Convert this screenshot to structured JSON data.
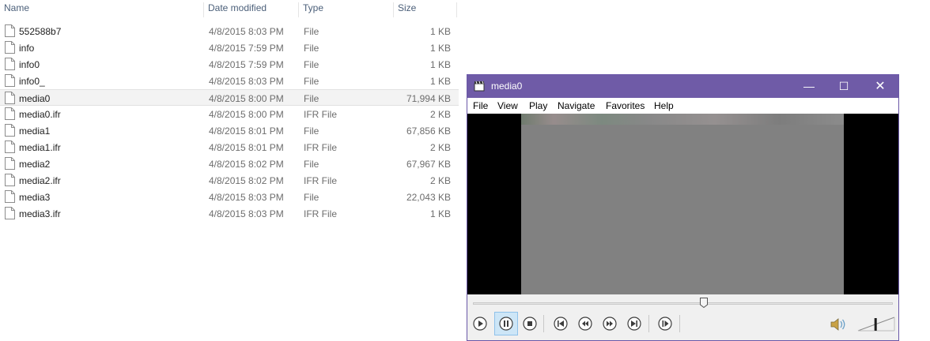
{
  "explorer": {
    "columns": {
      "name": "Name",
      "date": "Date modified",
      "type": "Type",
      "size": "Size"
    },
    "files": [
      {
        "name": "552588b7",
        "date": "4/8/2015 8:03 PM",
        "type": "File",
        "size": "1 KB"
      },
      {
        "name": "info",
        "date": "4/8/2015 7:59 PM",
        "type": "File",
        "size": "1 KB"
      },
      {
        "name": "info0",
        "date": "4/8/2015 7:59 PM",
        "type": "File",
        "size": "1 KB"
      },
      {
        "name": "info0_",
        "date": "4/8/2015 8:03 PM",
        "type": "File",
        "size": "1 KB"
      },
      {
        "name": "media0",
        "date": "4/8/2015 8:00 PM",
        "type": "File",
        "size": "71,994 KB"
      },
      {
        "name": "media0.ifr",
        "date": "4/8/2015 8:00 PM",
        "type": "IFR File",
        "size": "2 KB"
      },
      {
        "name": "media1",
        "date": "4/8/2015 8:01 PM",
        "type": "File",
        "size": "67,856 KB"
      },
      {
        "name": "media1.ifr",
        "date": "4/8/2015 8:01 PM",
        "type": "IFR File",
        "size": "2 KB"
      },
      {
        "name": "media2",
        "date": "4/8/2015 8:02 PM",
        "type": "File",
        "size": "67,967 KB"
      },
      {
        "name": "media2.ifr",
        "date": "4/8/2015 8:02 PM",
        "type": "IFR File",
        "size": "2 KB"
      },
      {
        "name": "media3",
        "date": "4/8/2015 8:03 PM",
        "type": "File",
        "size": "22,043 KB"
      },
      {
        "name": "media3.ifr",
        "date": "4/8/2015 8:03 PM",
        "type": "IFR File",
        "size": "1 KB"
      }
    ],
    "selected_index": 4
  },
  "player": {
    "title": "media0",
    "window_buttons": {
      "minimize": "—",
      "maximize": "☐",
      "close": "✕"
    },
    "menu": [
      "File",
      "View",
      "Play",
      "Navigate",
      "Favorites",
      "Help"
    ],
    "seek_position": 0.55,
    "volume_level": 0.45,
    "state": "playing",
    "accent": "#6f5ba7",
    "icons": [
      "play-icon",
      "pause-icon",
      "stop-icon",
      "skip-back-icon",
      "rewind-icon",
      "fast-forward-icon",
      "skip-forward-icon",
      "step-frame-icon",
      "speaker-icon"
    ]
  }
}
